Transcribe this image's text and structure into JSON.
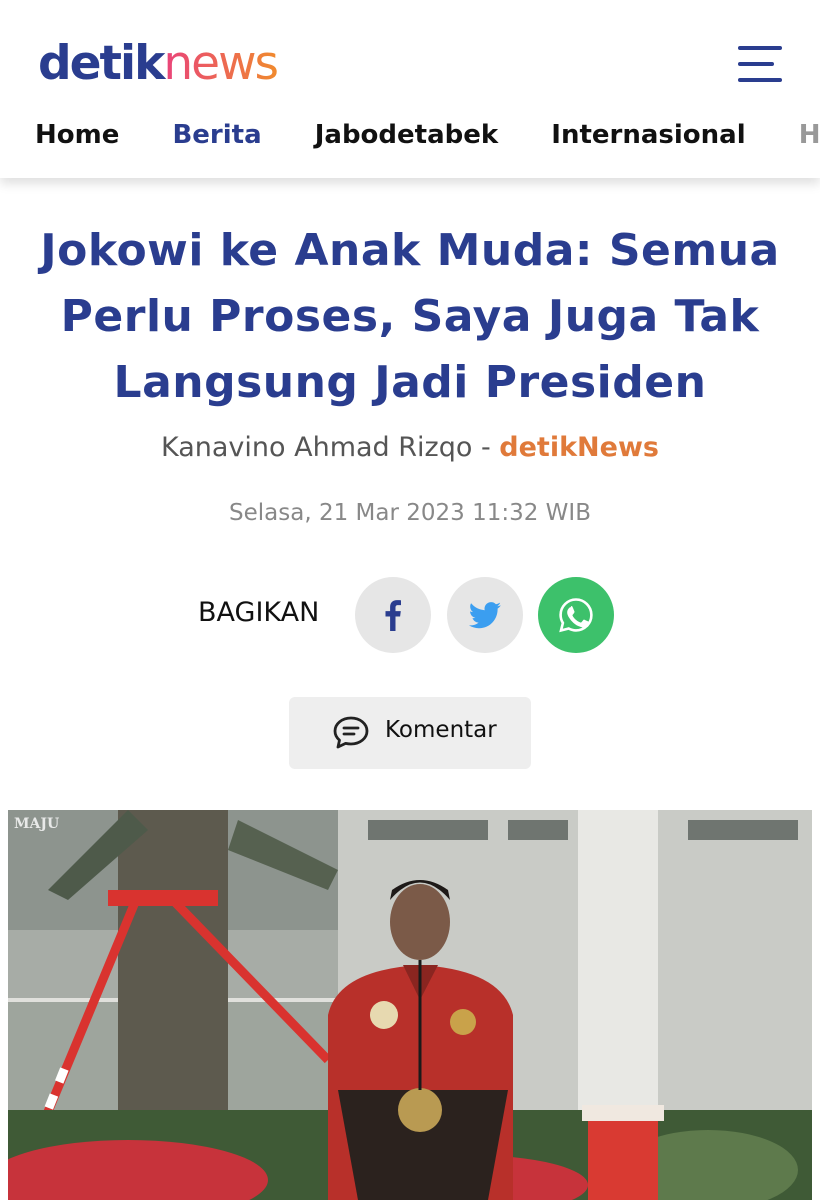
{
  "header": {
    "logo_part1": "detik",
    "logo_part2": "news",
    "nav": [
      "Home",
      "Berita",
      "Jabodetabek",
      "Internasional",
      "Hu"
    ],
    "active_nav": "Berita"
  },
  "article": {
    "title": "Jokowi ke Anak Muda: Semua Perlu Proses, Saya Juga Tak Langsung Jadi Presiden",
    "author": "Kanavino Ahmad Rizqo",
    "separator": " - ",
    "source": "detikNews",
    "date": "Selasa, 21 Mar 2023 11:32 WIB"
  },
  "share": {
    "label": "BAGIKAN",
    "buttons": [
      "facebook-icon",
      "twitter-icon",
      "whatsapp-icon"
    ]
  },
  "comment_button": {
    "label": "Komentar",
    "icon": "comment-icon"
  },
  "photo": {
    "watermark": "MAJU"
  },
  "colors": {
    "brand_blue": "#2a3d8f",
    "source_orange": "#e07a3a",
    "whatsapp_green": "#3dc16b"
  }
}
